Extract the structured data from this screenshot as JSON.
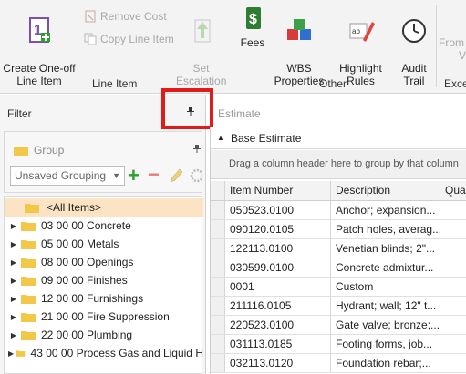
{
  "ribbon": {
    "create_line_item": "Create One-off\nLine Item",
    "remove_cost": "Remove Cost",
    "copy_line_item": "Copy Line Item",
    "set_escalation": "Set\nEscalation",
    "group_line_item": "Line Item",
    "fees": "Fees",
    "wbs_properties": "WBS\nProperties",
    "highlight_rules": "Highlight\nRules",
    "audit_trail": "Audit\nTrail",
    "from_partial": "From",
    "v_partial": "V",
    "group_other": "Other",
    "group_exce": "Exce"
  },
  "filter": {
    "title": "Filter",
    "group_title": "Group",
    "grouping_value": "Unsaved Grouping",
    "tree": [
      {
        "label": "<All Items>",
        "selected": true,
        "expandable": false
      },
      {
        "label": "03 00 00 Concrete",
        "selected": false,
        "expandable": true
      },
      {
        "label": "05 00 00 Metals",
        "selected": false,
        "expandable": true
      },
      {
        "label": "08 00 00 Openings",
        "selected": false,
        "expandable": true
      },
      {
        "label": "09 00 00 Finishes",
        "selected": false,
        "expandable": true
      },
      {
        "label": "12 00 00 Furnishings",
        "selected": false,
        "expandable": true
      },
      {
        "label": "21 00 00 Fire Suppression",
        "selected": false,
        "expandable": true
      },
      {
        "label": "22 00 00 Plumbing",
        "selected": false,
        "expandable": true
      },
      {
        "label": "43 00 00 Process Gas and Liquid H",
        "selected": false,
        "expandable": true
      }
    ]
  },
  "estimate": {
    "title": "Estimate",
    "base_estimate": "Base Estimate",
    "drag_hint": "Drag a column header here to group by that column",
    "columns": [
      "Item Number",
      "Description",
      "Qua"
    ],
    "rows": [
      [
        "050523.0100",
        "Anchor; expansion...",
        ""
      ],
      [
        "090120.0105",
        "Patch holes, averag...",
        ""
      ],
      [
        "122113.0100",
        "Venetian blinds; 2\"...",
        ""
      ],
      [
        "030599.0100",
        "Concrete admixtur...",
        ""
      ],
      [
        "0001",
        "Custom",
        ""
      ],
      [
        "211116.0105",
        "Hydrant; wall; 12\" t...",
        ""
      ],
      [
        "220523.0100",
        "Gate valve; bronze;...",
        ""
      ],
      [
        "031113.0185",
        "Footing forms, job...",
        ""
      ],
      [
        "032113.0120",
        "Foundation rebar;...",
        ""
      ]
    ]
  },
  "colors": {
    "highlight_box": "#e31a1a",
    "selected_row": "#fbe3c3",
    "folder": "#f2c84b",
    "add_green": "#2e9e2e",
    "remove_red": "#e57b7b"
  }
}
